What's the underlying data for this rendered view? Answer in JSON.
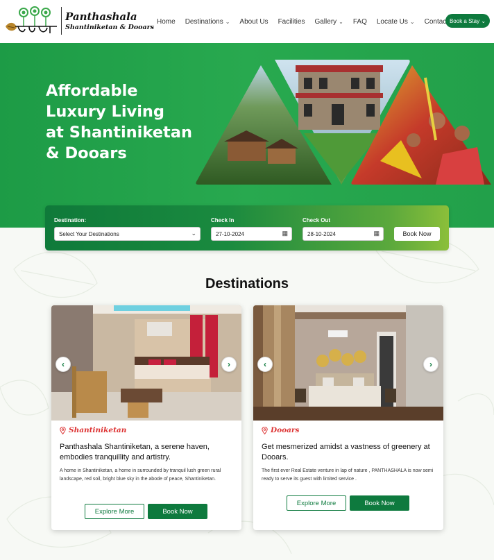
{
  "brand": {
    "logo_text": "পান্থশালা",
    "name": "Panthashala",
    "subtitle": "Shantiniketan & Dooars"
  },
  "nav": {
    "items": [
      {
        "label": "Home",
        "has_dropdown": false
      },
      {
        "label": "Destinations",
        "has_dropdown": true
      },
      {
        "label": "About Us",
        "has_dropdown": false
      },
      {
        "label": "Facilities",
        "has_dropdown": false
      },
      {
        "label": "Gallery",
        "has_dropdown": true
      },
      {
        "label": "FAQ",
        "has_dropdown": false
      },
      {
        "label": "Locate Us",
        "has_dropdown": true
      },
      {
        "label": "Contact Us",
        "has_dropdown": false
      }
    ],
    "cta_label": "Book a Stay"
  },
  "hero": {
    "title_lines": [
      "Affordable",
      "Luxury Living",
      "at Shantiniketan",
      "& Dooars"
    ]
  },
  "booking": {
    "destination_label": "Destination:",
    "destination_value": "Select Your Destinations",
    "checkin_label": "Check In",
    "checkin_value": "27-10-2024",
    "checkout_label": "Check Out",
    "checkout_value": "28-10-2024",
    "submit_label": "Book Now"
  },
  "destinations": {
    "title": "Destinations",
    "cards": [
      {
        "location": "Shantiniketan",
        "heading": "Panthashala Shantiniketan, a serene haven, embodies tranquillity and artistry.",
        "body": "A home in Shantiniketan, a home in surrounded by tranquil lush green rural landscape, red soil, bright blue sky in the abode of peace, Shantiniketan.",
        "explore_label": "Explore More",
        "book_label": "Book Now"
      },
      {
        "location": "Dooars",
        "heading": "Get mesmerized amidst a vastness of greenery at Dooars.",
        "body": "The first ever Real Estate venture in lap of nature , PANTHASHALA is now semi ready to serve its guest with limited service .",
        "explore_label": "Explore More",
        "book_label": "Book Now"
      }
    ]
  },
  "icons": {
    "chevron": "chevron-down-icon",
    "calendar": "calendar-icon",
    "location": "location-pin-icon",
    "prev": "chevron-left-icon",
    "next": "chevron-right-icon"
  },
  "colors": {
    "brand_green": "#0e7a3e",
    "hero_green": "#22a04a",
    "location_red": "#d33333"
  }
}
